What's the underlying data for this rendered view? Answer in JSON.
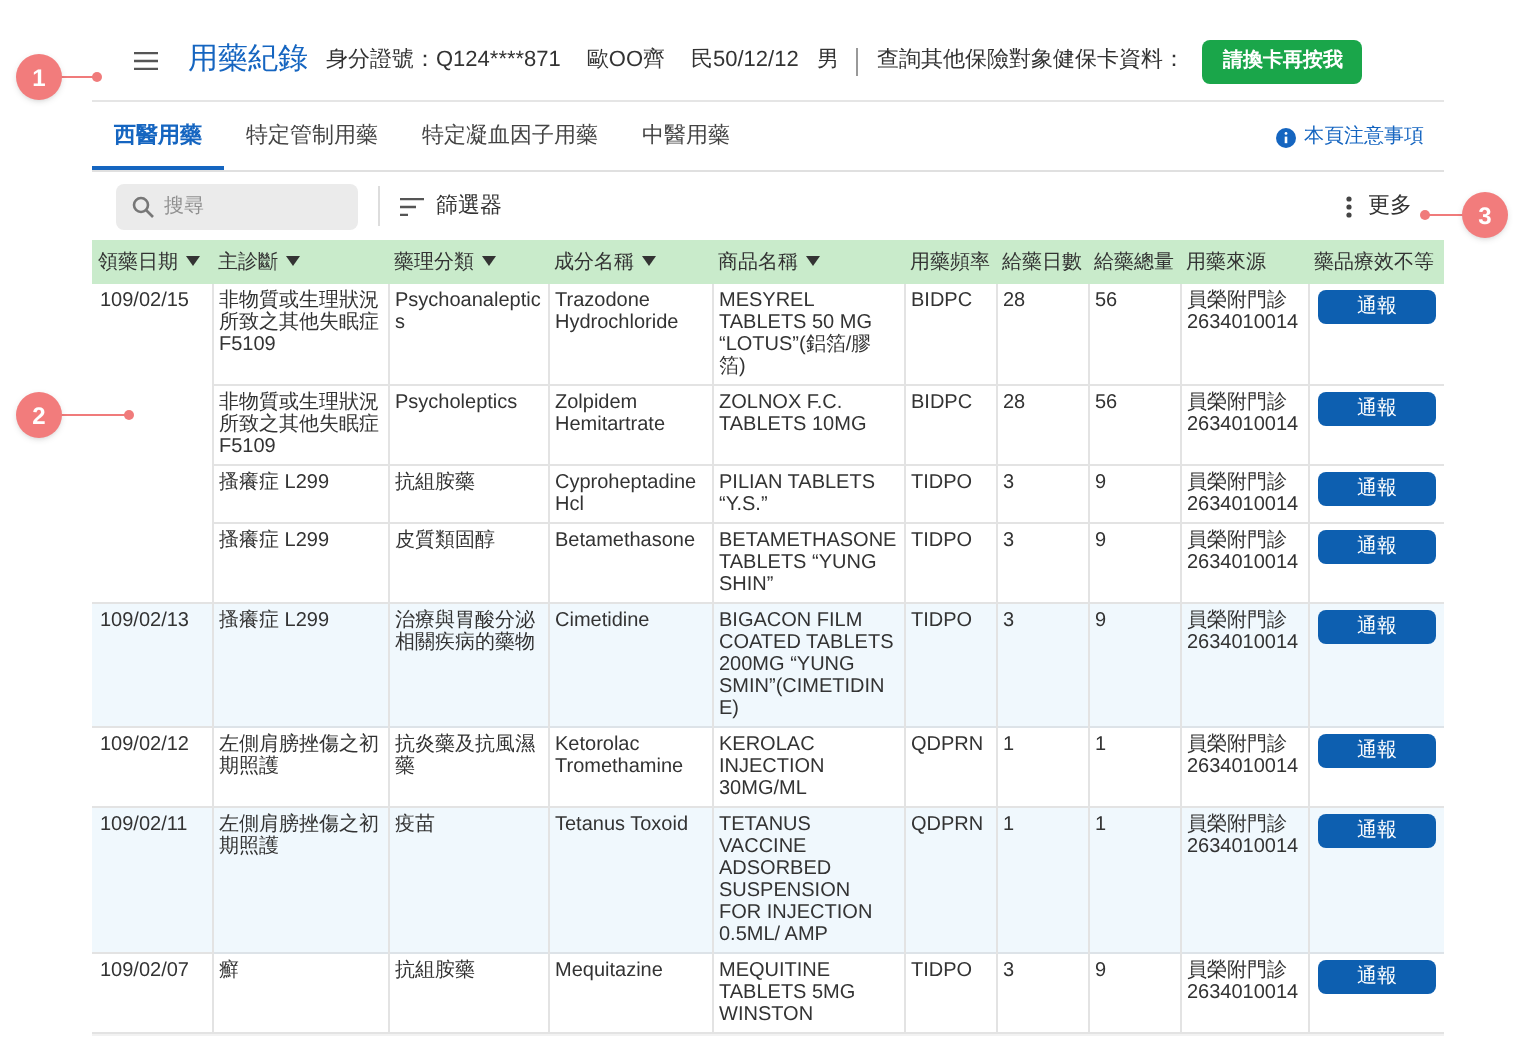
{
  "header": {
    "title": "用藥紀錄",
    "id_label": "身分證號：Q124****871",
    "name": "歐OO齊",
    "birth": "民50/12/12",
    "sex": "男",
    "query_label": "查詢其他保險對象健保卡資料：",
    "query_button": "請換卡再按我"
  },
  "tabs": [
    {
      "label": "西醫用藥",
      "selected": true
    },
    {
      "label": "特定管制用藥",
      "selected": false
    },
    {
      "label": "特定凝血因子用藥",
      "selected": false
    },
    {
      "label": "中醫用藥",
      "selected": false
    }
  ],
  "notice_link": "本頁注意事項",
  "toolbar": {
    "search": {
      "placeholder": "搜尋"
    },
    "filter": "篩選器",
    "more": "更多"
  },
  "table": {
    "columns": [
      {
        "label": "領藥日期",
        "sortable": true
      },
      {
        "label": "主診斷",
        "sortable": true
      },
      {
        "label": "藥理分類",
        "sortable": true
      },
      {
        "label": "成分名稱",
        "sortable": true
      },
      {
        "label": "商品名稱",
        "sortable": true
      },
      {
        "label": "用藥頻率",
        "sortable": false
      },
      {
        "label": "給藥日數",
        "sortable": false
      },
      {
        "label": "給藥總量",
        "sortable": false
      },
      {
        "label": "用藥來源",
        "sortable": false
      },
      {
        "label": "藥品療效不等",
        "sortable": false
      }
    ],
    "groups": [
      {
        "date": "109/02/15",
        "shaded": false,
        "rows": [
          {
            "cells": [
              "非物質或生理狀況所致之其他失眠症 F5109",
              "Psychoanaleptics",
              "Trazodone Hydrochloride",
              "MESYREL TABLETS 50 MG “LOTUS”(鋁箔/膠箔)",
              "BIDPC",
              "28",
              "56",
              "員榮附門診 2634010014"
            ],
            "action": "通報"
          },
          {
            "cells": [
              "非物質或生理狀況所致之其他失眠症 F5109",
              "Psycholeptics",
              "Zolpidem Hemitartrate",
              "ZOLNOX F.C. TABLETS 10MG",
              "BIDPC",
              "28",
              "56",
              "員榮附門診 2634010014"
            ],
            "action": "通報"
          },
          {
            "cells": [
              "搔癢症 L299",
              "抗組胺藥",
              "Cyproheptadine Hcl",
              "PILIAN TABLETS “Y.S.”",
              "TIDPO",
              "3",
              "9",
              "員榮附門診 2634010014"
            ],
            "action": "通報"
          },
          {
            "cells": [
              "搔癢症 L299",
              "皮質類固醇",
              "Betamethasone",
              "BETAMETHASONE TABLETS “YUNG SHIN”",
              "TIDPO",
              "3",
              "9",
              "員榮附門診 2634010014"
            ],
            "action": "通報"
          }
        ]
      },
      {
        "date": "109/02/13",
        "shaded": true,
        "rows": [
          {
            "cells": [
              "搔癢症 L299",
              "治療與胃酸分泌相關疾病的藥物",
              "Cimetidine",
              "BIGACON FILM COATED TABLETS 200MG “YUNG SMIN”(CIMETIDINE)",
              "TIDPO",
              "3",
              "9",
              "員榮附門診 2634010014"
            ],
            "action": "通報"
          }
        ]
      },
      {
        "date": "109/02/12",
        "shaded": false,
        "rows": [
          {
            "cells": [
              "左側肩膀挫傷之初期照護",
              "抗炎藥及抗風濕藥",
              "Ketorolac Tromethamine",
              "KEROLAC INJECTION 30MG/ML",
              "QDPRN",
              "1",
              "1",
              "員榮附門診 2634010014"
            ],
            "action": "通報"
          }
        ]
      },
      {
        "date": "109/02/11",
        "shaded": true,
        "rows": [
          {
            "cells": [
              "左側肩膀挫傷之初期照護",
              "疫苗",
              "Tetanus Toxoid",
              "TETANUS VACCINE ADSORBED SUSPENSION FOR INJECTION 0.5ML/ AMP",
              "QDPRN",
              "1",
              "1",
              "員榮附門診 2634010014"
            ],
            "action": "通報"
          }
        ]
      },
      {
        "date": "109/02/07",
        "shaded": false,
        "rows": [
          {
            "cells": [
              "癬",
              "抗組胺藥",
              "Mequitazine",
              "MEQUITINE TABLETS 5MG WINSTON",
              "TIDPO",
              "3",
              "9",
              "員榮附門診 2634010014"
            ],
            "action": "通報"
          }
        ]
      }
    ]
  },
  "callouts": [
    {
      "number": "1"
    },
    {
      "number": "2"
    },
    {
      "number": "3"
    }
  ]
}
